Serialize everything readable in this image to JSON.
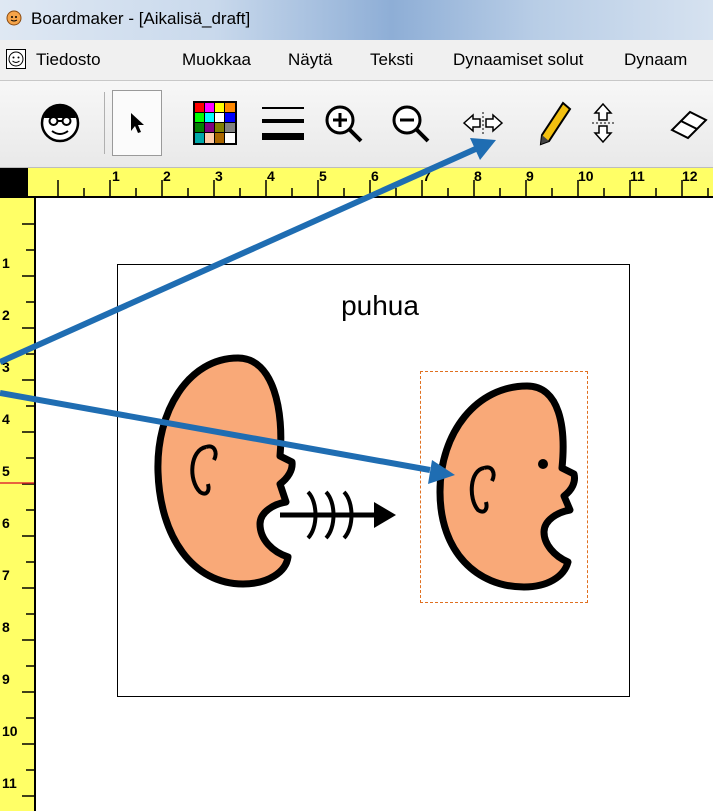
{
  "window": {
    "title": "Boardmaker - [Aikalisä_draft]"
  },
  "menu": {
    "items": [
      "Tiedosto",
      "Muokkaa",
      "Näytä",
      "Teksti",
      "Dynaamiset solut",
      "Dynaam"
    ]
  },
  "toolbar": {
    "buttons": [
      "symbol-finder",
      "pointer",
      "color",
      "line-thickness",
      "zoom-in",
      "zoom-out",
      "cell-width",
      "pencil",
      "cell-height",
      "eraser"
    ],
    "pressed": "pointer"
  },
  "ruler": {
    "top_numbers": [
      "1",
      "2",
      "3",
      "4",
      "5",
      "6",
      "7",
      "8",
      "9",
      "10",
      "11",
      "12"
    ],
    "left_numbers": [
      "1",
      "2",
      "3",
      "4",
      "5",
      "6",
      "7",
      "8",
      "9",
      "10",
      "11"
    ]
  },
  "board": {
    "cell_label": "puhua"
  },
  "colors": {
    "ruler": "#ffff66",
    "arrow": "#1f6db2",
    "face": "#f9a978",
    "selection": "#e07020"
  }
}
